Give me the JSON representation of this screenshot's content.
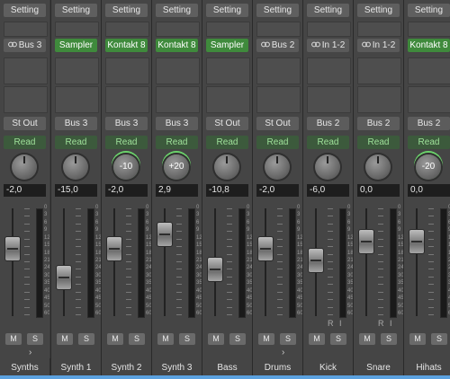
{
  "colors": {
    "accent_green": "#3f8a3c",
    "automation_green": "#9fe19a",
    "selection_blue": "#5ba1df",
    "send_knob_ring_green": "#6bd36b"
  },
  "strips": [
    {
      "setting_label": "Setting",
      "insert_label": "Bus 3",
      "insert_icon": "link-icon",
      "insert_kind": "gray",
      "output_label": "St Out",
      "automation_label": "Read",
      "send_value": "",
      "level_value": "-2,0",
      "fader_level": 0.66,
      "meter_overlay": "",
      "solo_label": "S",
      "mute_label": "M",
      "name": "Synths",
      "show_chevron": true
    },
    {
      "setting_label": "Setting",
      "insert_label": "Sampler",
      "insert_icon": "",
      "insert_kind": "green",
      "output_label": "Bus 3",
      "automation_label": "Read",
      "send_value": "",
      "level_value": "-15,0",
      "fader_level": 0.32,
      "meter_overlay": "",
      "solo_label": "S",
      "mute_label": "M",
      "name": "Synth 1",
      "show_chevron": false
    },
    {
      "setting_label": "Setting",
      "insert_label": "Kontakt 8",
      "insert_icon": "",
      "insert_kind": "green",
      "output_label": "Bus 3",
      "automation_label": "Read",
      "send_value": "-10",
      "level_value": "-2,0",
      "fader_level": 0.66,
      "meter_overlay": "",
      "solo_label": "S",
      "mute_label": "M",
      "name": "Synth 2",
      "show_chevron": false
    },
    {
      "setting_label": "Setting",
      "insert_label": "Kontakt 8",
      "insert_icon": "",
      "insert_kind": "green",
      "output_label": "Bus 3",
      "automation_label": "Read",
      "send_value": "+20",
      "level_value": "2,9",
      "fader_level": 0.83,
      "meter_overlay": "",
      "solo_label": "S",
      "mute_label": "M",
      "name": "Synth 3",
      "show_chevron": false
    },
    {
      "setting_label": "Setting",
      "insert_label": "Sampler",
      "insert_icon": "",
      "insert_kind": "green",
      "output_label": "St Out",
      "automation_label": "Read",
      "send_value": "",
      "level_value": "-10,8",
      "fader_level": 0.41,
      "meter_overlay": "",
      "solo_label": "S",
      "mute_label": "M",
      "name": "Bass",
      "show_chevron": false
    },
    {
      "setting_label": "Setting",
      "insert_label": "Bus 2",
      "insert_icon": "link-icon",
      "insert_kind": "gray",
      "output_label": "St Out",
      "automation_label": "Read",
      "send_value": "",
      "level_value": "-2,0",
      "fader_level": 0.66,
      "meter_overlay": "",
      "solo_label": "S",
      "mute_label": "M",
      "name": "Drums",
      "show_chevron": true
    },
    {
      "setting_label": "Setting",
      "insert_label": "In 1-2",
      "insert_icon": "link-icon",
      "insert_kind": "gray",
      "output_label": "Bus 2",
      "automation_label": "Read",
      "send_value": "",
      "level_value": "-6,0",
      "fader_level": 0.52,
      "meter_overlay": "R I",
      "solo_label": "S",
      "mute_label": "M",
      "name": "Kick",
      "show_chevron": false
    },
    {
      "setting_label": "Setting",
      "insert_label": "In 1-2",
      "insert_icon": "link-icon",
      "insert_kind": "gray",
      "output_label": "Bus 2",
      "automation_label": "Read",
      "send_value": "",
      "level_value": "0,0",
      "fader_level": 0.74,
      "meter_overlay": "R I",
      "solo_label": "S",
      "mute_label": "M",
      "name": "Snare",
      "show_chevron": false
    },
    {
      "setting_label": "Setting",
      "insert_label": "Kontakt 8",
      "insert_icon": "",
      "insert_kind": "green",
      "output_label": "Bus 2",
      "automation_label": "Read",
      "send_value": "-20",
      "level_value": "0,0",
      "fader_level": 0.74,
      "meter_overlay": "",
      "solo_label": "S",
      "mute_label": "M",
      "name": "Hihats",
      "show_chevron": false
    }
  ],
  "fader_scale_labels": [
    "0",
    "3",
    "6",
    "9",
    "12",
    "15",
    "18",
    "21",
    "24",
    "30",
    "35",
    "40",
    "45",
    "50",
    "60"
  ]
}
